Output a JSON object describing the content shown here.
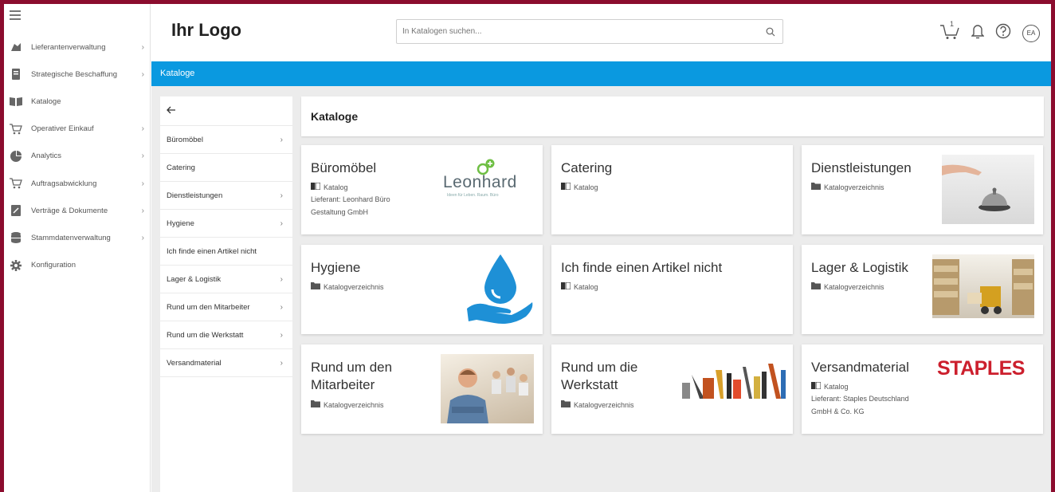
{
  "sidebar": {
    "items": [
      {
        "label": "Lieferantenverwaltung",
        "icon": "supplier-icon"
      },
      {
        "label": "Strategische Beschaffung",
        "icon": "document-icon"
      },
      {
        "label": "Kataloge",
        "icon": "catalog-book-icon"
      },
      {
        "label": "Operativer Einkauf",
        "icon": "cart-icon"
      },
      {
        "label": "Analytics",
        "icon": "pie-chart-icon"
      },
      {
        "label": "Auftragsabwicklung",
        "icon": "cart-check-icon"
      },
      {
        "label": "Verträge & Dokumente",
        "icon": "contract-icon"
      },
      {
        "label": "Stammdatenverwaltung",
        "icon": "database-icon"
      },
      {
        "label": "Konfiguration",
        "icon": "gear-icon"
      }
    ]
  },
  "header": {
    "logo": "Ihr Logo",
    "search_placeholder": "In Katalogen suchen...",
    "avatar_initials": "EA",
    "cart_count": "1"
  },
  "breadcrumb": {
    "label": "Kataloge"
  },
  "subnav": {
    "items": [
      {
        "label": "Büromöbel"
      },
      {
        "label": "Catering"
      },
      {
        "label": "Dienstleistungen"
      },
      {
        "label": "Hygiene"
      },
      {
        "label": "Ich finde einen Artikel nicht"
      },
      {
        "label": "Lager & Logistik"
      },
      {
        "label": "Rund um den Mitarbeiter"
      },
      {
        "label": "Rund um die Werkstatt"
      },
      {
        "label": "Versandmaterial"
      }
    ]
  },
  "main": {
    "title": "Kataloge",
    "cards": [
      {
        "title": "Büromöbel",
        "type": "Katalog",
        "supplier": "Lieferant: Leonhard Büro Gestaltung GmbH",
        "logo_text": "Leonhard",
        "logo_tagline": "Ideen für Leben. Raum. Büro"
      },
      {
        "title": "Catering",
        "type": "Katalog"
      },
      {
        "title": "Dienstleistungen",
        "type": "Katalogverzeichnis"
      },
      {
        "title": "Hygiene",
        "type": "Katalogverzeichnis"
      },
      {
        "title": "Ich finde einen Artikel nicht",
        "type": "Katalog"
      },
      {
        "title": "Lager & Logistik",
        "type": "Katalogverzeichnis"
      },
      {
        "title": "Rund um den Mitarbeiter",
        "type": "Katalogverzeichnis"
      },
      {
        "title": "Rund um die Werkstatt",
        "type": "Katalogverzeichnis"
      },
      {
        "title": "Versandmaterial",
        "type": "Katalog",
        "supplier": "Lieferant: Staples Deutschland GmbH & Co. KG",
        "logo_text": "STAPLES"
      }
    ]
  },
  "colors": {
    "accent": "#0a99e0",
    "frame": "#8b0c2e",
    "hygiene_blue": "#1e90d6",
    "staples_red": "#cc1f2d",
    "leonhard_green": "#6fbf44"
  }
}
